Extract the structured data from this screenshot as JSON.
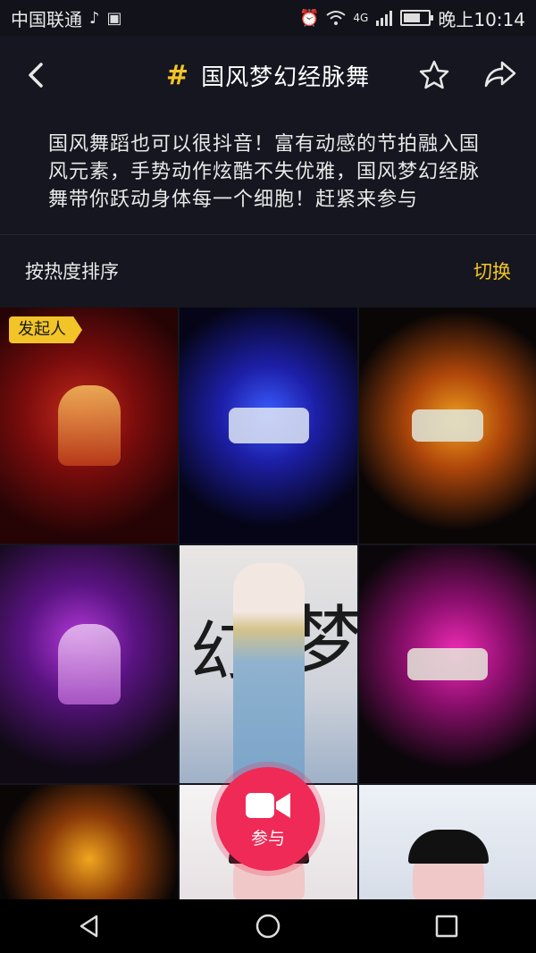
{
  "status_bar": {
    "carrier": "中国联通",
    "network": "4G",
    "time": "晚上10:14"
  },
  "header": {
    "title": "国风梦幻经脉舞",
    "hash_symbol": "#"
  },
  "description": "国风舞蹈也可以很抖音！富有动感的节拍融入国风元素，手势动作炫酷不失优雅，国风梦幻经脉舞带你跃动身体每一个细胞！赶紧来参与",
  "sort": {
    "label": "按热度排序",
    "switch": "切换"
  },
  "grid": {
    "initiator_badge": "发起人",
    "calligraphy_1": "幻",
    "calligraphy_2": "梦"
  },
  "join_button": {
    "label": "参与"
  },
  "colors": {
    "accent_yellow": "#f3c428",
    "join_red": "#ef2a56",
    "background": "#15161f"
  }
}
